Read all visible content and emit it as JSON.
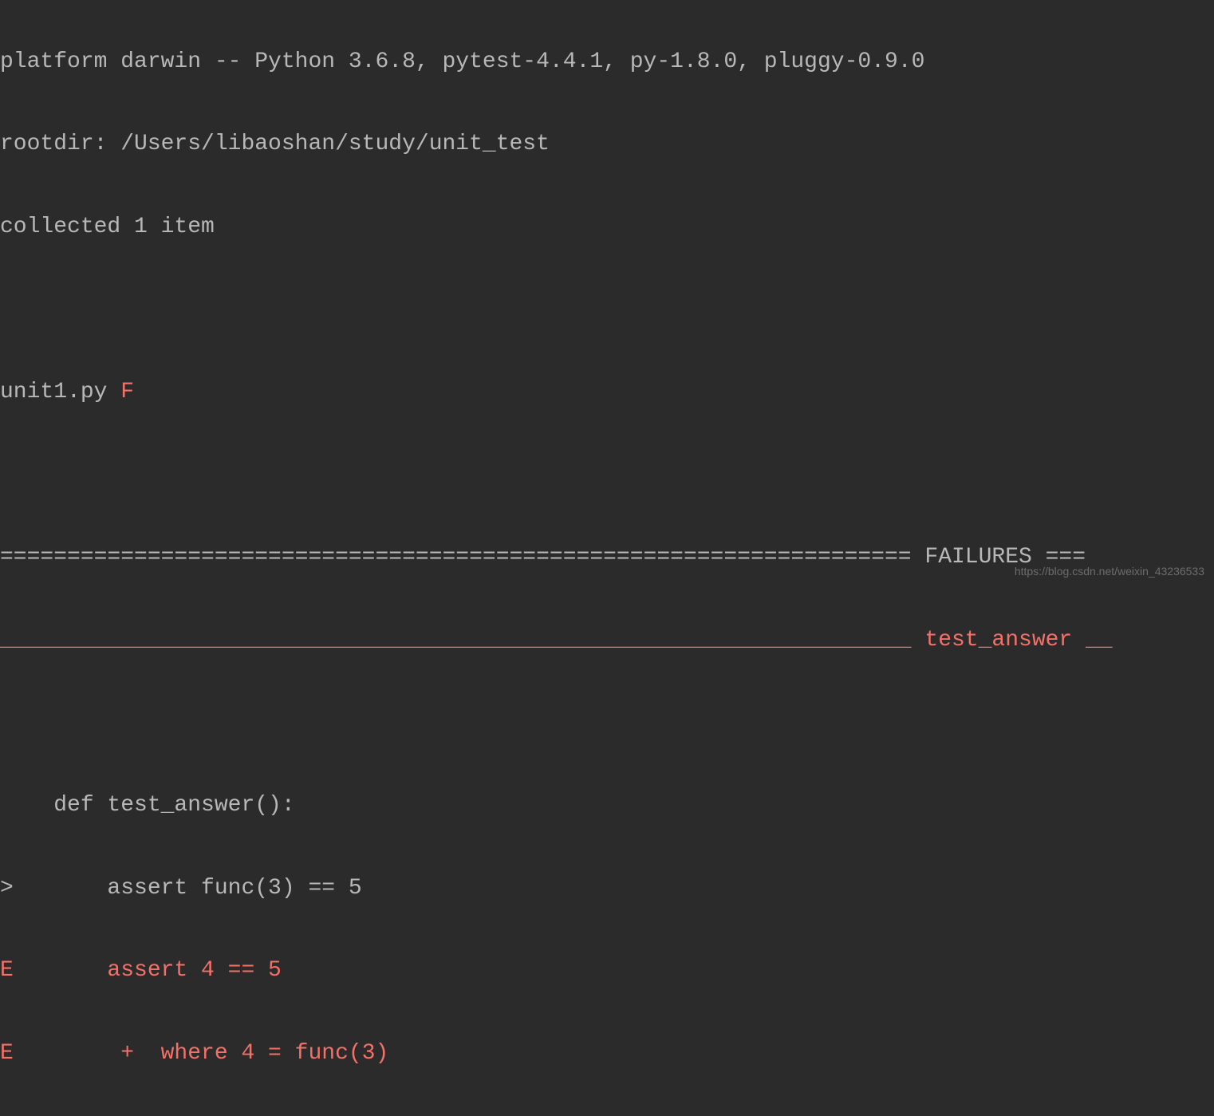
{
  "header": {
    "platform_line": "platform darwin -- Python 3.6.8, pytest-4.4.1, py-1.8.0, pluggy-0.9.0",
    "rootdir_line": "rootdir: /Users/libaoshan/study/unit_test",
    "collected_line": "collected 1 item"
  },
  "result": {
    "file_name": "unit1.py ",
    "status": "F"
  },
  "failures": {
    "separator_prefix": "==================================================================== ",
    "separator_label": "FAILURES",
    "separator_suffix": " ===",
    "test_separator_prefix": "____________________________________________________________________ ",
    "test_name": "test_answer",
    "test_separator_suffix": " __"
  },
  "code": {
    "def_line": "    def test_answer():",
    "assert_line": ">       assert func(3) == 5",
    "error_line1": "E       assert 4 == 5",
    "error_line2": "E        +  where 4 = func(3)"
  },
  "watermark": "https://blog.csdn.net/weixin_43236533"
}
